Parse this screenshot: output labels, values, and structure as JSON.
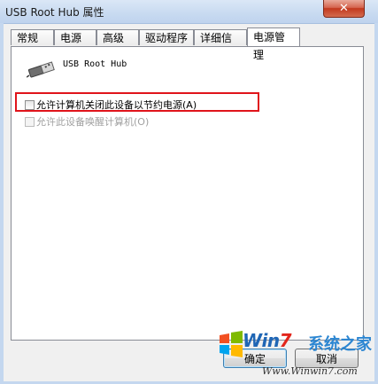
{
  "window": {
    "title": "USB Root Hub 属性",
    "close_glyph": "✕"
  },
  "tabs": [
    {
      "label": "常规"
    },
    {
      "label": "电源"
    },
    {
      "label": "高级"
    },
    {
      "label": "驱动程序"
    },
    {
      "label": "详细信息"
    },
    {
      "label": "电源管理",
      "active": true
    }
  ],
  "device": {
    "name": "USB Root Hub",
    "icon": "usb-plug-icon"
  },
  "options": {
    "allow_turn_off": {
      "label": "允许计算机关闭此设备以节约电源(A)",
      "checked": false,
      "enabled": true
    },
    "allow_wake": {
      "label": "允许此设备唤醒计算机(O)",
      "checked": false,
      "enabled": false
    }
  },
  "buttons": {
    "ok_label": "确定",
    "cancel_label": "取消"
  },
  "watermark": {
    "brand_prefix": "Win",
    "brand_suffix": "7",
    "brand_cn": "系统之家",
    "url": "Www.Winwin7.com"
  },
  "colors": {
    "highlight": "#e0141b",
    "title_bar": "#c9dbf1"
  }
}
